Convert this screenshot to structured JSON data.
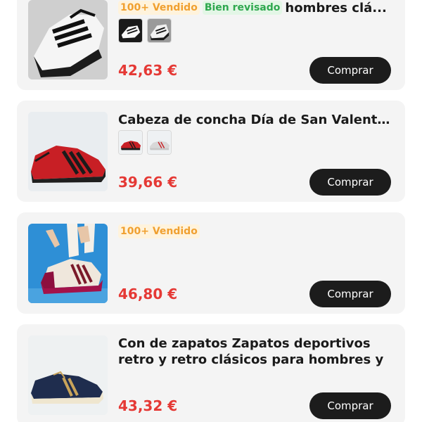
{
  "products": [
    {
      "badges": [
        {
          "text": "100+ Vendido",
          "kind": "sold"
        },
        {
          "text": "Bien revisado",
          "kind": "checked"
        }
      ],
      "title": "hombres clá...",
      "price": "42,63 €",
      "buy_label": "Comprar",
      "image_icon": "black-white-sneaker-image",
      "swatches": [
        "black-sneaker-swatch",
        "white-sneaker-swatch"
      ]
    },
    {
      "badges": [],
      "title": "Cabeza de concha Día de San Valent...",
      "price": "39,66 €",
      "buy_label": "Comprar",
      "image_icon": "red-black-sneaker-image",
      "swatches": [
        "red-sneaker-swatch",
        "white-red-sneaker-swatch"
      ]
    },
    {
      "badges": [
        {
          "text": "100+ Vendido",
          "kind": "sold"
        }
      ],
      "title": "",
      "price": "46,80 €",
      "buy_label": "Comprar",
      "image_icon": "burgundy-cream-sneaker-image",
      "swatches": []
    },
    {
      "badges": [],
      "title": "Con de zapatos Zapatos deportivos retro y retro clásicos para hombres y",
      "price": "43,32 €",
      "buy_label": "Comprar",
      "image_icon": "navy-gold-sneaker-image",
      "swatches": []
    }
  ],
  "colors": {
    "price": "#e53935",
    "button_bg": "#1c1c1c",
    "card_bg": "#f4f4f4",
    "sold_badge": "#f0a030",
    "checked_badge": "#2fa84f"
  }
}
